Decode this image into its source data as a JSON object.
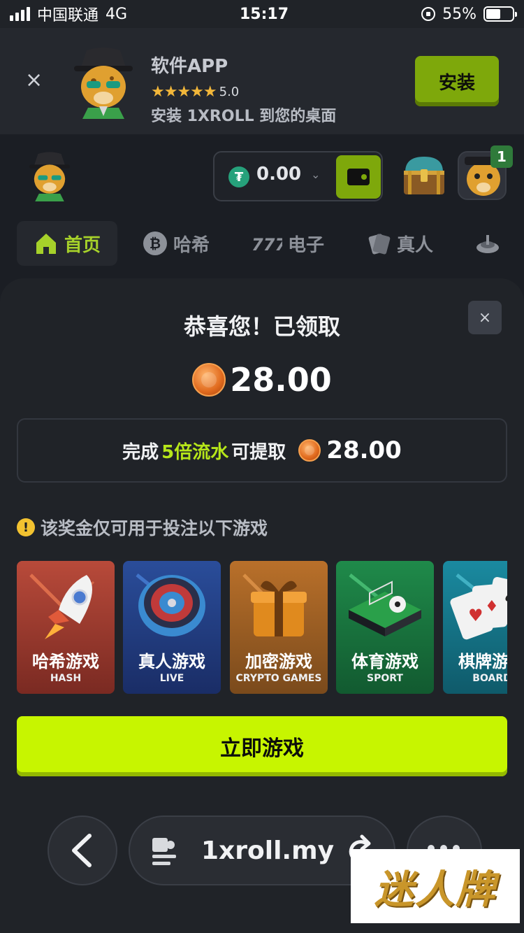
{
  "status_bar": {
    "carrier": "中国联通",
    "network": "4G",
    "time": "15:17",
    "battery": "55%",
    "battery_level": 0.55,
    "signal_bars": 4
  },
  "app_banner": {
    "title": "软件APP",
    "rating": "5.0",
    "stars": 5,
    "description": "安装 1XROLL 到您的桌面",
    "install_label": "安装",
    "close_label": "×"
  },
  "header": {
    "balance": "0.00",
    "currency_icon": "tether-icon",
    "notification_count": "1"
  },
  "nav": {
    "items": [
      {
        "label": "首页",
        "icon": "home-icon",
        "active": true
      },
      {
        "label": "哈希",
        "icon": "bitcoin-icon",
        "active": false
      },
      {
        "label": "电子",
        "icon": "slots-777-icon",
        "active": false
      },
      {
        "label": "真人",
        "icon": "cards-icon",
        "active": false
      },
      {
        "label": "",
        "icon": "roulette-icon",
        "active": false
      }
    ]
  },
  "modal": {
    "close_label": "×",
    "title": "恭喜您！已领取",
    "amount": "28.00",
    "wager_prefix": "完成",
    "wager_highlight": "5倍流水",
    "wager_suffix": "可提取",
    "wager_amount": "28.00",
    "notice": "该奖金仅可用于投注以下游戏",
    "games": [
      {
        "cn": "哈希游戏",
        "en": "HASH",
        "color_top": "#b84a3a",
        "color_bottom": "#7a2a22"
      },
      {
        "cn": "真人游戏",
        "en": "LIVE",
        "color_top": "#2a4d9a",
        "color_bottom": "#1a2d66"
      },
      {
        "cn": "加密游戏",
        "en": "CRYPTO GAMES",
        "color_top": "#b9702a",
        "color_bottom": "#7a4a1c"
      },
      {
        "cn": "体育游戏",
        "en": "SPORT",
        "color_top": "#1f8a4a",
        "color_bottom": "#125a30"
      },
      {
        "cn": "棋牌游戏",
        "en": "BOARD",
        "color_top": "#1a8aa0",
        "color_bottom": "#0f5a6a"
      }
    ],
    "play_label": "立即游戏"
  },
  "browser": {
    "url": "1xroll.my"
  },
  "watermark": {
    "text": "迷人牌"
  }
}
